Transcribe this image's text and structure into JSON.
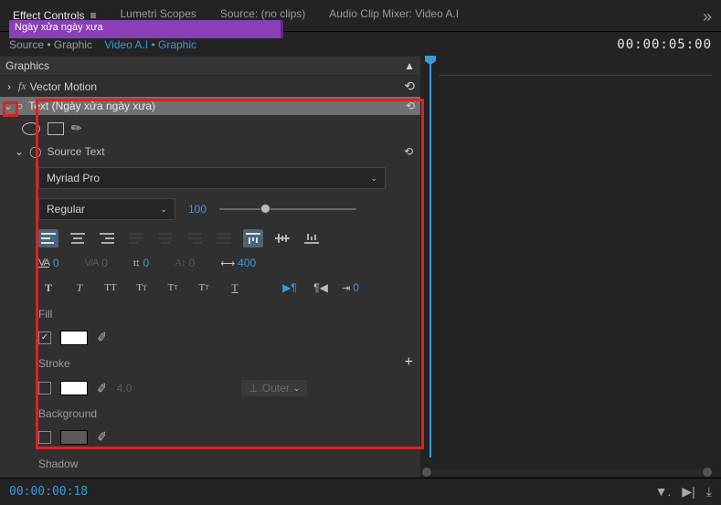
{
  "tabs": {
    "effect_controls": "Effect Controls",
    "lumetri": "Lumetri Scopes",
    "source": "Source: (no clips)",
    "audio_mixer": "Audio Clip Mixer: Video A.I"
  },
  "subheader": {
    "source_label": "Source",
    "source_name": "Graphic",
    "seq_name": "Video A.I",
    "seq_item": "Graphic",
    "ruler_time": "00:00:05:00"
  },
  "rows": {
    "graphics": "Graphics",
    "vector_motion": "Vector Motion",
    "text_effect": "Text (Ngày xửa ngày xưa)",
    "source_text": "Source Text",
    "shadow": "Shadow"
  },
  "clip_label": "Ngày xửa ngày xưa",
  "font": {
    "family": "Myriad Pro",
    "style": "Regular",
    "size": "100"
  },
  "metrics": {
    "tracking": "0",
    "kerning": "0",
    "baseline": "0",
    "leading": "0",
    "tsume": "400"
  },
  "icons": {
    "tracking": "VA",
    "kerning": "V/A",
    "baseline": "t↕",
    "leading": "A↕",
    "tsume": "⟷"
  },
  "fill": {
    "label": "Fill",
    "color": "#ffffff"
  },
  "stroke": {
    "label": "Stroke",
    "color": "#ffffff",
    "width": "4.0",
    "mode": "Outer"
  },
  "background": {
    "label": "Background",
    "color": "#5a5a5a"
  },
  "footer_tc": "00:00:00:18",
  "reset_glyph": "⟲",
  "dd_caret": "⌄"
}
